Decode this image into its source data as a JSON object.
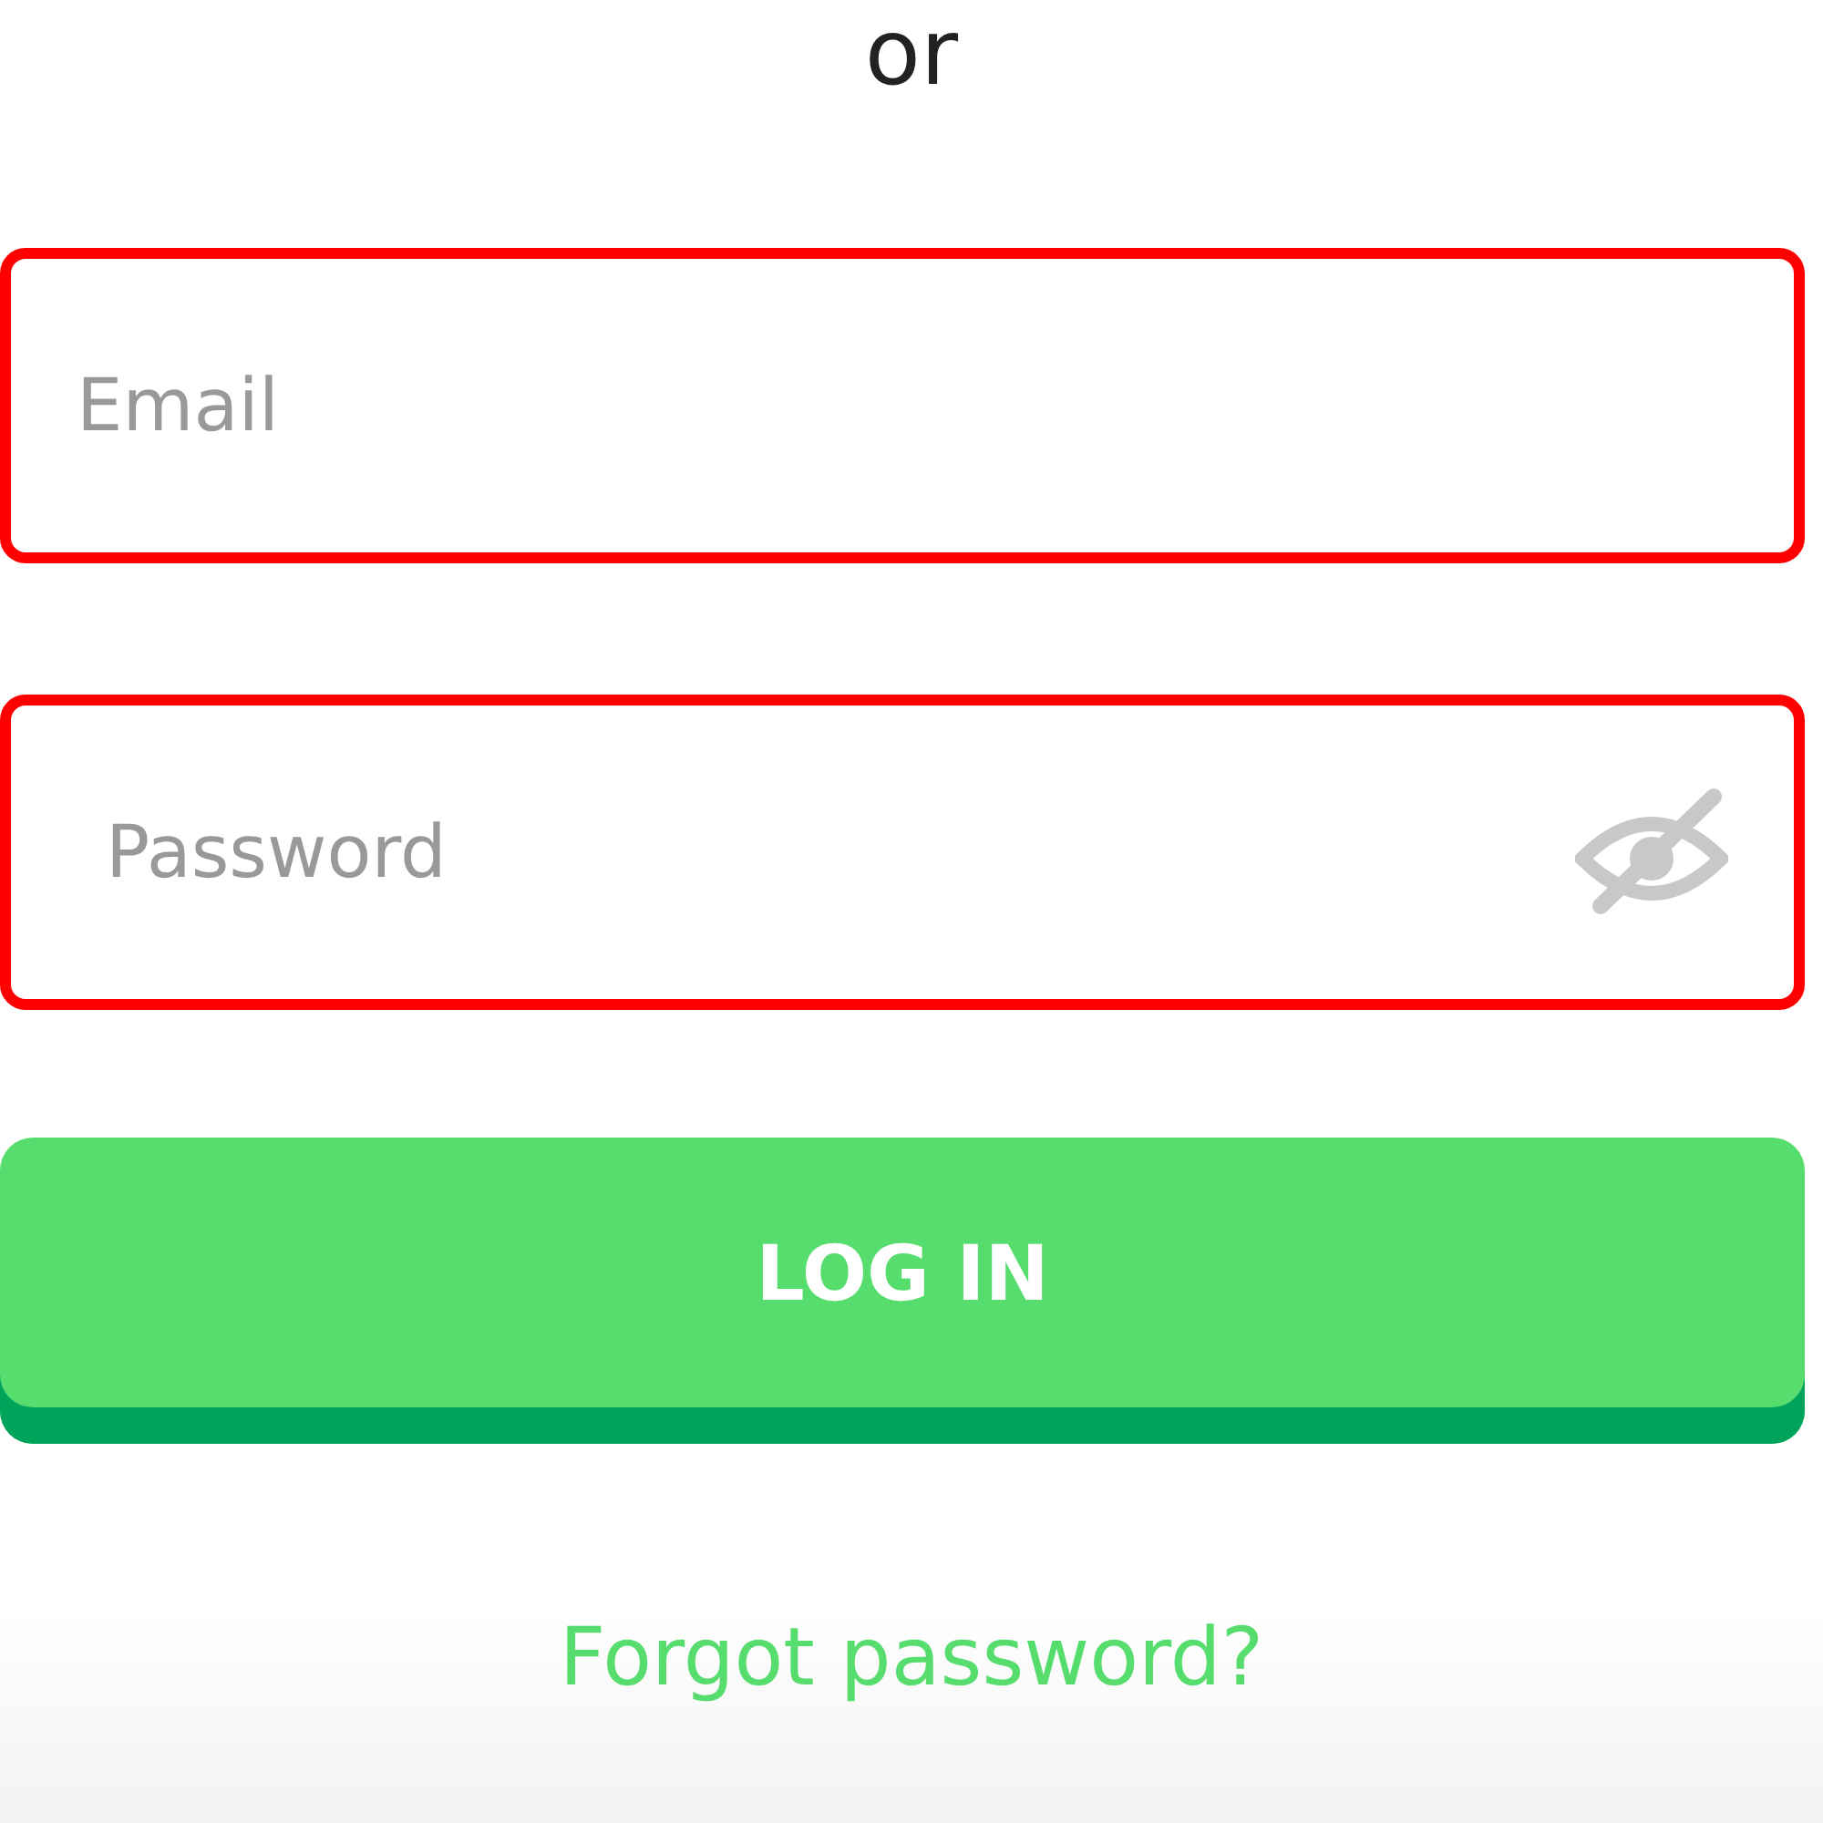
{
  "divider_text": "or",
  "fields": [
    {
      "kind": "email",
      "placeholder": "Email",
      "error": true
    },
    {
      "kind": "password",
      "placeholder": "Password",
      "error": true
    }
  ],
  "login_button": "LOG IN",
  "forgot_link": "Forgot password?"
}
